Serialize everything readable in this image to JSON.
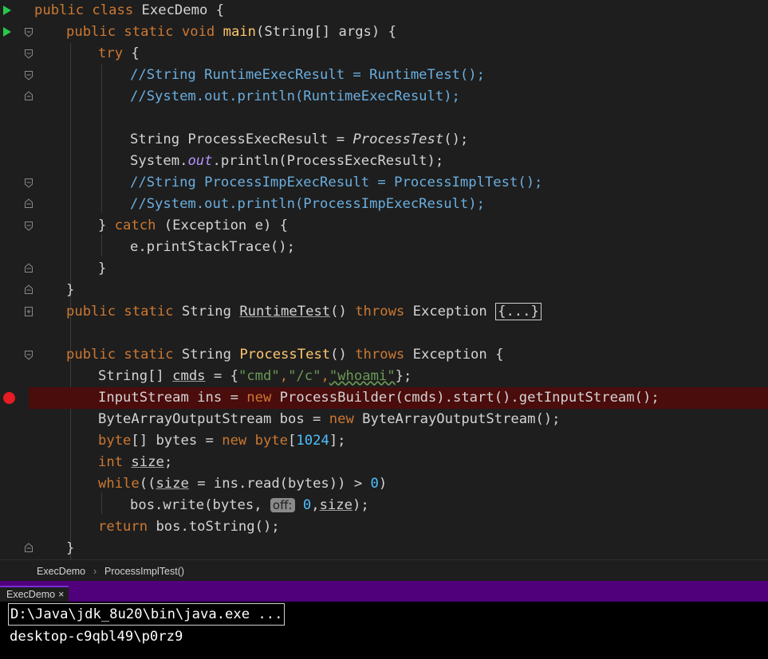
{
  "editor": {
    "lines": {
      "l1": {
        "a": "public class ",
        "b": "ExecDemo {"
      },
      "l2": {
        "a": "public static void ",
        "b": "main",
        "c": "(String[] args) {"
      },
      "l3": {
        "a": "try",
        "b": " {"
      },
      "l4": {
        "a": "//String RuntimeExecResult = RuntimeTest();"
      },
      "l5": {
        "a": "//System.out.println(RuntimeExecResult);"
      },
      "l7": {
        "a": "String ProcessExecResult = ",
        "b": "ProcessTest",
        "c": "();"
      },
      "l8": {
        "a": "System.",
        "b": "out",
        "c": ".println(ProcessExecResult);"
      },
      "l9": {
        "a": "//String ProcessImpExecResult = ProcessImplTest();"
      },
      "l10": {
        "a": "//System.out.println(ProcessImpExecResult);"
      },
      "l11": {
        "a": "} ",
        "b": "catch",
        " c": " (Exception e) {",
        "c": " (Exception e) {"
      },
      "l12": {
        "a": "e.printStackTrace();"
      },
      "l13": {
        "a": "}"
      },
      "l14": {
        "a": "}"
      },
      "l15": {
        "a": "public static ",
        "b": "String ",
        "c": "RuntimeTest",
        "d": "() ",
        "e": "throws ",
        "f": "Exception ",
        "g": "{...}"
      },
      "l17": {
        "a": "public static ",
        "b": "String ",
        "c": "ProcessTest",
        "d": "() ",
        "e": "throws ",
        "f": "Exception {"
      },
      "l18": {
        "a": "String[] ",
        "b": "cmds",
        " c": " = {",
        "c": " = {",
        "d": "\"cmd\"",
        "e": ",",
        "f": "\"/c\"",
        "g": ",",
        "h": "\"whoami\"",
        "i": "};"
      },
      "l19": {
        "a": "InputStream ins = ",
        "b": "new ",
        "c": "ProcessBuilder(cmds).start().getInputStream();"
      },
      "l20": {
        "a": "ByteArrayOutputStream bos = ",
        "b": "new ",
        "c": "ByteArrayOutputStream();"
      },
      "l21": {
        "a": "byte",
        "b": "[] bytes = ",
        "c": "new ",
        "d": "byte",
        "e": "[",
        "f": "1024",
        "g": "];"
      },
      "l22": {
        "a": "int ",
        "b": "size",
        "c": ";"
      },
      "l23": {
        "a": "while",
        "b": "((",
        "c": "size",
        "d": " = ins.read(bytes)) > ",
        "e": "0",
        "f": ")"
      },
      "l24": {
        "a": "bos.write(bytes, ",
        "b": "off:",
        "c": " ",
        "d": "0",
        "e": ",",
        "f": "size",
        "g": ");"
      },
      "l25": {
        "a": "return ",
        "b": "bos.toString();"
      },
      "l26": {
        "a": "}"
      }
    }
  },
  "breadcrumb": {
    "item1": "ExecDemo",
    "sep": "›",
    "item2": "ProcessImplTest()"
  },
  "run": {
    "tab_label": "ExecDemo",
    "close": "×"
  },
  "console": {
    "command": "D:\\Java\\jdk_8u20\\bin\\java.exe ...",
    "output": "desktop-c9qbl49\\p0rz9"
  },
  "colors": {
    "keyword": "#cc7832",
    "method": "#ffc66d",
    "comment": "#6aaedf",
    "number": "#4ec0ff",
    "string": "#6a9955",
    "breakpoint": "#e51c23",
    "run_arrow": "#27c94a",
    "run_bar": "#4f007a"
  }
}
